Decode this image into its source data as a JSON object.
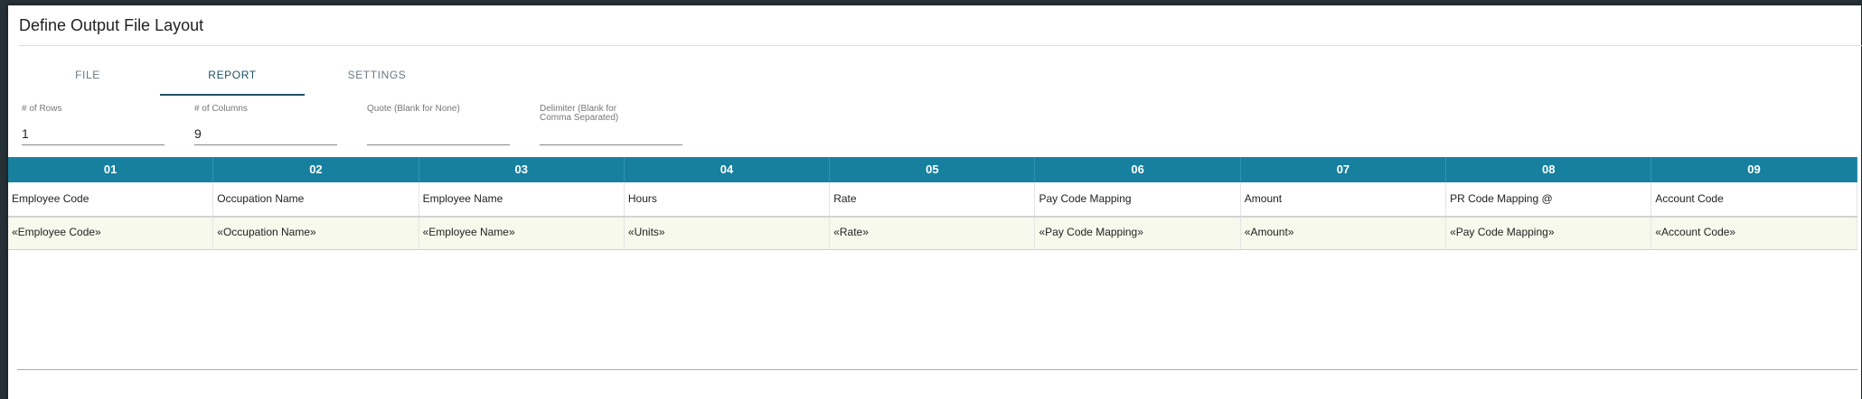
{
  "dialog": {
    "title": "Define Output File Layout"
  },
  "tabs": [
    {
      "label": "FILE"
    },
    {
      "label": "REPORT"
    },
    {
      "label": "SETTINGS"
    }
  ],
  "active_tab": "REPORT",
  "fields": {
    "rows": {
      "label": "# of Rows",
      "value": "1"
    },
    "columns": {
      "label": "# of Columns",
      "value": "9"
    },
    "quote": {
      "label": "Quote (Blank for None)",
      "value": ""
    },
    "delimiter": {
      "label": "Delimiter (Blank for Comma Separated)",
      "value": ""
    }
  },
  "grid": {
    "column_numbers": [
      "01",
      "02",
      "03",
      "04",
      "05",
      "06",
      "07",
      "08",
      "09"
    ],
    "column_names": [
      "Employee Code",
      "Occupation Name",
      "Employee Name",
      "Hours",
      "Rate",
      "Pay Code Mapping",
      "Amount",
      "PR Code Mapping @",
      "Account Code"
    ],
    "merge_fields": [
      "«Employee Code»",
      "«Occupation Name»",
      "«Employee Name»",
      "«Units»",
      "«Rate»",
      "«Pay Code Mapping»",
      "«Amount»",
      "«Pay Code Mapping»",
      "«Account Code»"
    ]
  },
  "colors": {
    "header_bg": "#17809f",
    "merge_row_bg": "#f7f9ec",
    "active_tab": "#1f4f63"
  }
}
